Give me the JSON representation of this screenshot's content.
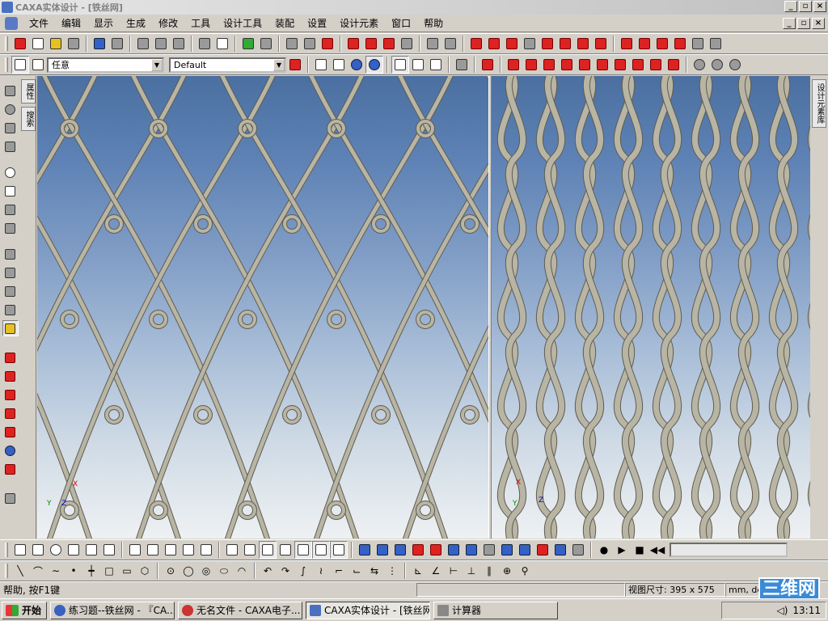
{
  "window": {
    "title": "CAXA实体设计 - [铁丝网]",
    "buttons": [
      "_",
      "▫",
      "×"
    ],
    "mdi_buttons": [
      "_",
      "▫",
      "×"
    ]
  },
  "menu": {
    "items": [
      "文件",
      "编辑",
      "显示",
      "生成",
      "修改",
      "工具",
      "设计工具",
      "装配",
      "设置",
      "设计元素",
      "窗口",
      "帮助"
    ]
  },
  "toolbar2": {
    "selection_filter": "任意",
    "style_combo": "Default"
  },
  "side_tabs": {
    "left": [
      "属性",
      "搜索"
    ],
    "right": "设计元素库"
  },
  "viewports": {
    "left": {
      "triad": {
        "x": "X",
        "y": "Y",
        "z": "Z"
      }
    },
    "right": {
      "triad": {
        "x": "X",
        "y": "Y",
        "z": "Z"
      }
    }
  },
  "status": {
    "help": "帮助, 按F1键",
    "view_size": "视图尺寸: 395 x 575",
    "units": "mm, deg"
  },
  "brand": "三维网",
  "taskbar": {
    "start": "开始",
    "tasks": [
      {
        "label": "练习题--铁丝网 - 『CA...",
        "active": false
      },
      {
        "label": "无名文件 - CAXA电子...",
        "active": false
      },
      {
        "label": "CAXA实体设计 - [铁丝网]",
        "active": true
      },
      {
        "label": "计算器",
        "active": false
      }
    ],
    "clock": "13:11"
  },
  "colors": {
    "wire": "#b9b5a4",
    "wire_dark": "#5f5c50",
    "bg_top": "#4a6fa0",
    "bg_bottom": "#eef1f3"
  }
}
